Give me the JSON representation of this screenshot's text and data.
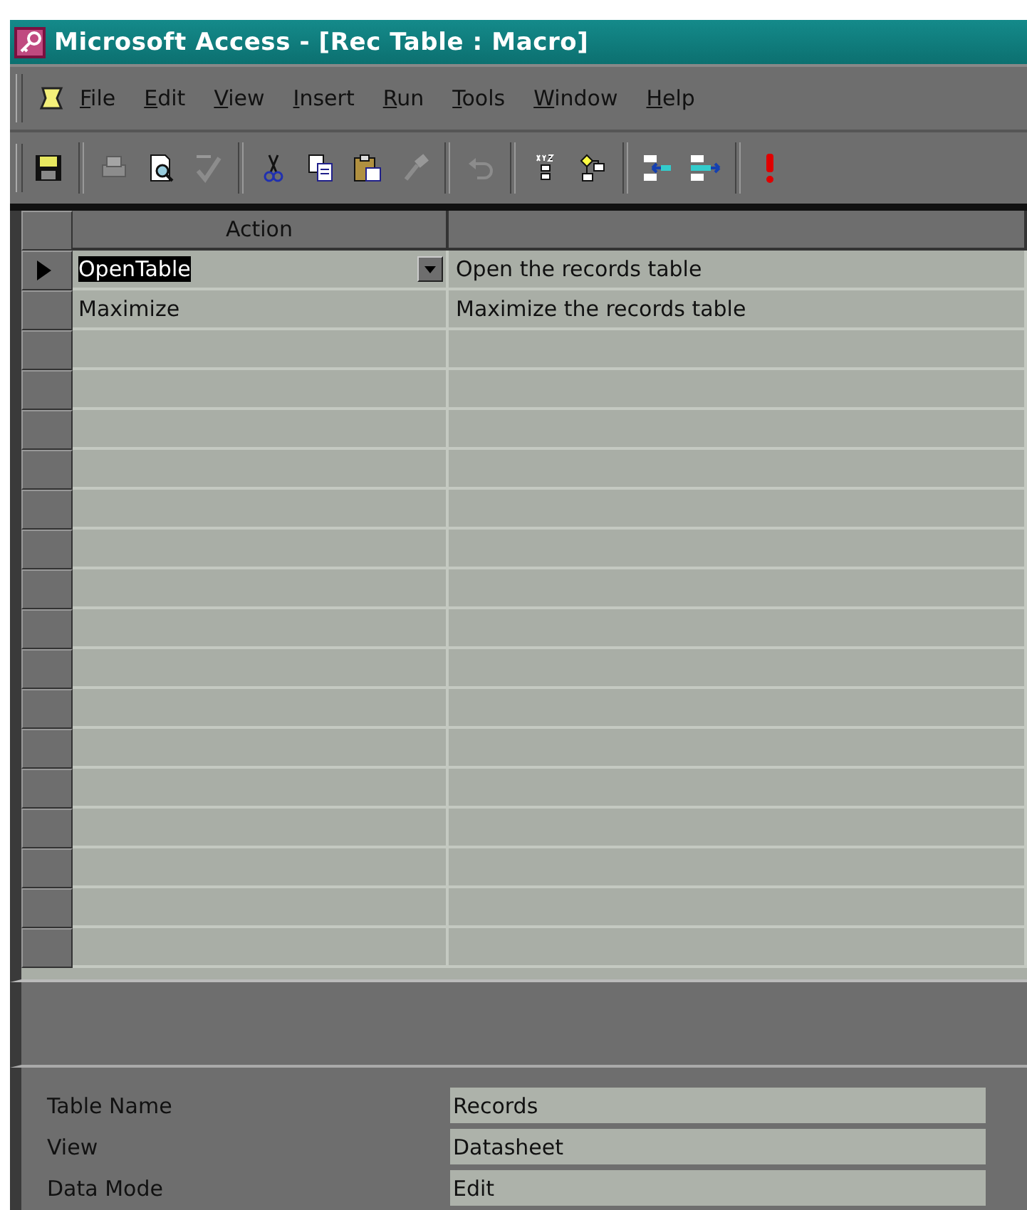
{
  "window": {
    "title": "Microsoft Access - [Rec Table : Macro]"
  },
  "menu": [
    "File",
    "Edit",
    "View",
    "Insert",
    "Run",
    "Tools",
    "Window",
    "Help"
  ],
  "toolbar": [
    {
      "kind": "save",
      "disabled": false
    },
    {
      "kind": "sep"
    },
    {
      "kind": "print",
      "disabled": true
    },
    {
      "kind": "preview",
      "disabled": false
    },
    {
      "kind": "spelling",
      "disabled": true
    },
    {
      "kind": "sep"
    },
    {
      "kind": "cut",
      "disabled": false
    },
    {
      "kind": "copy",
      "disabled": false
    },
    {
      "kind": "paste",
      "disabled": false
    },
    {
      "kind": "painter",
      "disabled": true
    },
    {
      "kind": "sep"
    },
    {
      "kind": "undo",
      "disabled": true
    },
    {
      "kind": "sep"
    },
    {
      "kind": "names",
      "disabled": false
    },
    {
      "kind": "conditions",
      "disabled": false
    },
    {
      "kind": "sep"
    },
    {
      "kind": "insert-rows",
      "disabled": false
    },
    {
      "kind": "delete-rows",
      "disabled": false
    },
    {
      "kind": "sep"
    },
    {
      "kind": "run",
      "disabled": false
    }
  ],
  "grid": {
    "columns": [
      "Action"
    ],
    "rows": [
      {
        "action": "OpenTable",
        "comment": "Open the records table",
        "selected": true
      },
      {
        "action": "Maximize",
        "comment": "Maximize the records table",
        "selected": false
      }
    ]
  },
  "arguments": [
    {
      "label": "Table Name",
      "value": "Records"
    },
    {
      "label": "View",
      "value": "Datasheet"
    },
    {
      "label": "Data Mode",
      "value": "Edit"
    }
  ]
}
